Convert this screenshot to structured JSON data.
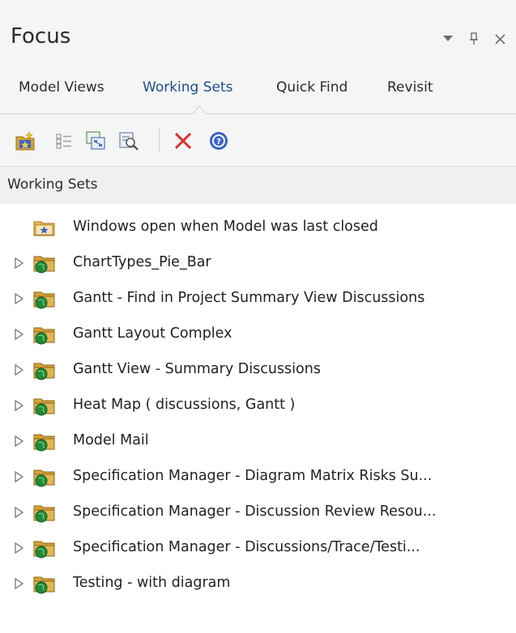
{
  "panel": {
    "title": "Focus"
  },
  "tabs": [
    {
      "label": "Model Views",
      "active": false
    },
    {
      "label": "Working Sets",
      "active": true
    },
    {
      "label": "Quick Find",
      "active": false
    },
    {
      "label": "Revisit",
      "active": false
    }
  ],
  "toolbar": {
    "icons": [
      "new-working-set-icon",
      "select-items-icon",
      "open-diagrams-icon",
      "find-icon",
      "delete-icon",
      "help-icon"
    ]
  },
  "section": {
    "label": "Working Sets"
  },
  "tree": {
    "items": [
      {
        "label": "Windows open when Model was last closed",
        "expandable": false,
        "icon": "star-folder-icon"
      },
      {
        "label": "ChartTypes_Pie_Bar",
        "expandable": true,
        "icon": "working-set-folder-icon"
      },
      {
        "label": "Gantt - Find in Project Summary View Discussions",
        "expandable": true,
        "icon": "working-set-folder-icon"
      },
      {
        "label": "Gantt Layout Complex",
        "expandable": true,
        "icon": "working-set-folder-icon"
      },
      {
        "label": "Gantt View - Summary Discussions",
        "expandable": true,
        "icon": "working-set-folder-icon"
      },
      {
        "label": "Heat Map ( discussions, Gantt )",
        "expandable": true,
        "icon": "working-set-folder-icon"
      },
      {
        "label": "Model Mail",
        "expandable": true,
        "icon": "working-set-folder-icon"
      },
      {
        "label": "Specification Manager - Diagram Matrix Risks Su...",
        "expandable": true,
        "icon": "working-set-folder-icon"
      },
      {
        "label": "Specification Manager - Discussion Review Resou...",
        "expandable": true,
        "icon": "working-set-folder-icon"
      },
      {
        "label": "Specification Manager - Discussions/Trace/Testi...",
        "expandable": true,
        "icon": "working-set-folder-icon"
      },
      {
        "label": "Testing - with diagram",
        "expandable": true,
        "icon": "working-set-folder-icon"
      }
    ]
  },
  "colors": {
    "active_tab": "#1d4e89",
    "folder": "#d4a33a",
    "globe": "#1f8a3a",
    "delete": "#d9302c",
    "help": "#3b63c6"
  }
}
